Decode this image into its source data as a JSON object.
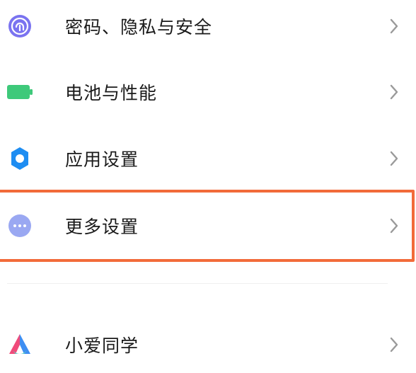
{
  "settings": {
    "items": [
      {
        "label": "密码、隐私与安全",
        "icon": "fingerprint-icon",
        "color": "#7a73f0"
      },
      {
        "label": "电池与性能",
        "icon": "battery-icon",
        "color": "#3ec97a"
      },
      {
        "label": "应用设置",
        "icon": "gear-icon",
        "color": "#1e8df2"
      },
      {
        "label": "更多设置",
        "icon": "more-dots-icon",
        "color": "#9aa8f2"
      },
      {
        "label": "小爱同学",
        "icon": "xiaoai-icon",
        "color": "#5fd0c6"
      }
    ]
  },
  "highlight": {
    "color": "#f26b3a"
  }
}
